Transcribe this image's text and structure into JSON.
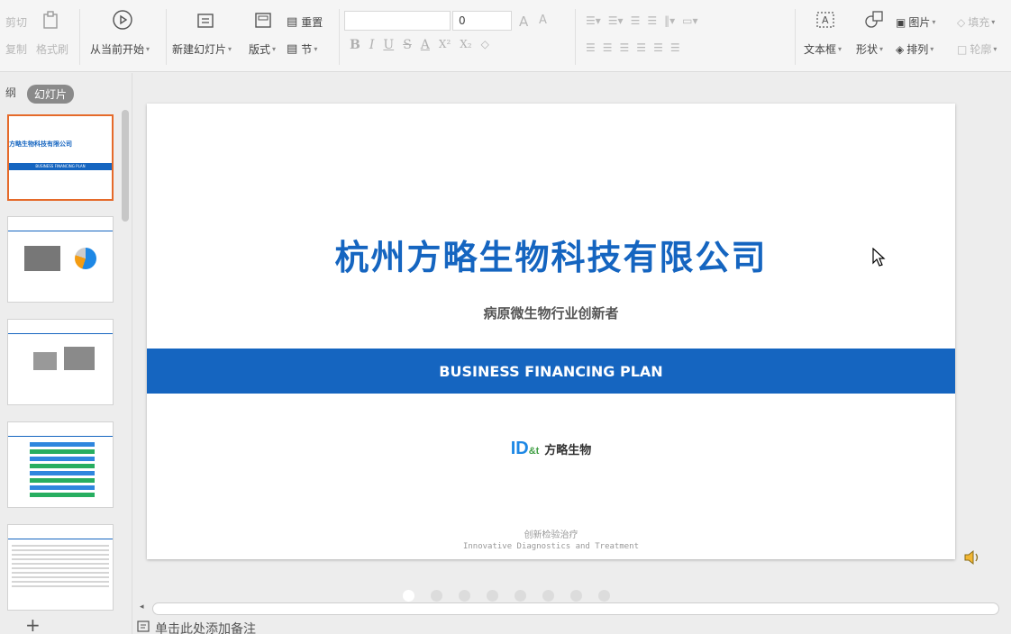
{
  "ribbon": {
    "clipboard": {
      "cut_label": "剪切",
      "copy_label": "复制",
      "format_painter_label": "格式刷"
    },
    "from_current_label": "从当前开始",
    "new_slide_label": "新建幻灯片",
    "layout_label": "版式",
    "reset_label": "重置",
    "section_label": "节",
    "font_size_value": "0",
    "textbox_label": "文本框",
    "shape_label": "形状",
    "picture_label": "图片",
    "fill_label": "填充",
    "arrange_label": "排列",
    "outline_label": "轮廓"
  },
  "left_panel": {
    "outline_tab_label": "纲",
    "slides_tab_label": "幻灯片",
    "thumb1_title": "方略生物科技有限公司",
    "thumb1_band": "BUSINESS FINANCING PLAN"
  },
  "slide": {
    "title": "杭州方略生物科技有限公司",
    "subtitle": "病原微生物行业创新者",
    "band_text": "BUSINESS FINANCING PLAN",
    "logo_mark": "ID",
    "logo_amp": "&t",
    "logo_name": "方略生物",
    "footer_cn": "创新检验治疗",
    "footer_en": "Innovative Diagnostics and Treatment"
  },
  "notes_placeholder": "单击此处添加备注",
  "add_slide_symbol": "+",
  "colors": {
    "accent": "#1565c0",
    "thumb_active_border": "#e56a2a"
  }
}
